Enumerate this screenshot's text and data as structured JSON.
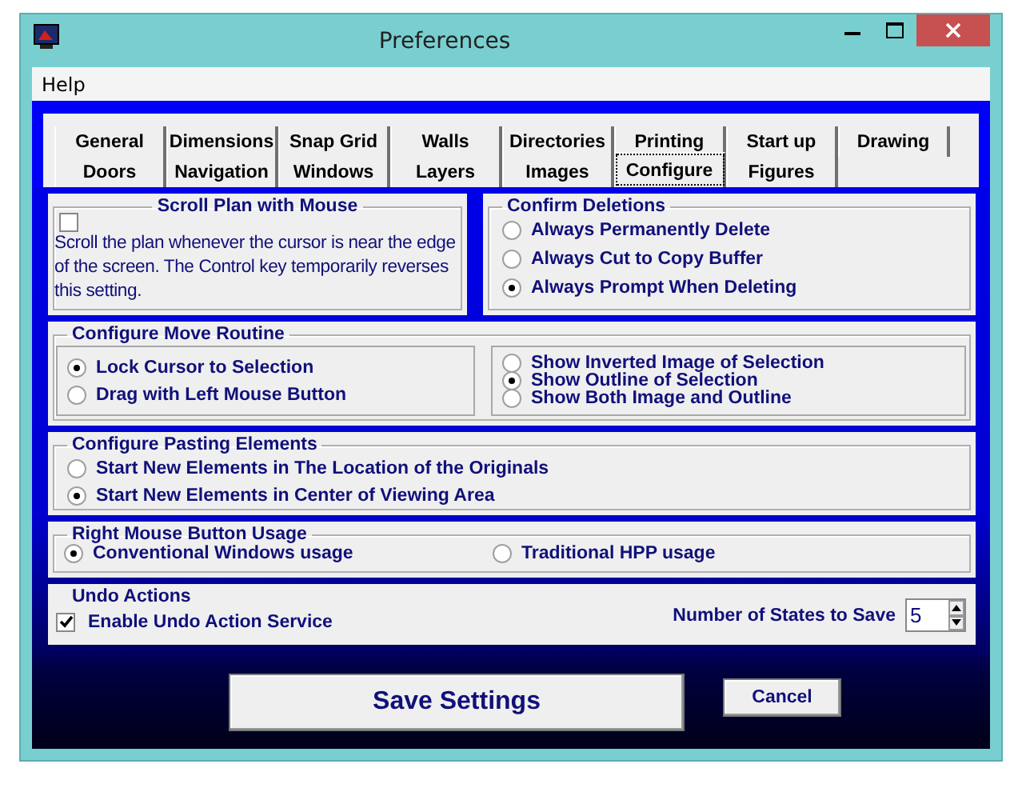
{
  "window": {
    "title": "Preferences"
  },
  "menu": [
    {
      "label": "Help"
    }
  ],
  "tab_rows": [
    {
      "tabs": [
        {
          "label": "General",
          "selected": false
        },
        {
          "label": "Dimensions",
          "selected": false
        },
        {
          "label": "Snap Grid",
          "selected": false
        },
        {
          "label": "Walls",
          "selected": false
        },
        {
          "label": "Directories",
          "selected": false
        },
        {
          "label": "Printing",
          "selected": false
        },
        {
          "label": "Start up",
          "selected": false
        },
        {
          "label": "Drawing",
          "selected": false
        }
      ]
    },
    {
      "tabs": [
        {
          "label": "Doors",
          "selected": false
        },
        {
          "label": "Navigation",
          "selected": false
        },
        {
          "label": "Windows",
          "selected": false
        },
        {
          "label": "Layers",
          "selected": false
        },
        {
          "label": "Images",
          "selected": false
        },
        {
          "label": "Configure",
          "selected": true
        },
        {
          "label": "Figures",
          "selected": false
        }
      ]
    }
  ],
  "scroll_plan": {
    "title": "Scroll Plan with Mouse",
    "checked": false,
    "description": "Scroll the plan whenever the cursor is near the edge of the screen. The Control key temporarily reverses this setting."
  },
  "confirm_deletions": {
    "title": "Confirm Deletions",
    "options": [
      {
        "label": "Always Permanently Delete",
        "selected": false
      },
      {
        "label": "Always Cut to Copy Buffer",
        "selected": false
      },
      {
        "label": "Always Prompt When Deleting",
        "selected": true
      }
    ]
  },
  "move_routine": {
    "title": "Configure Move Routine",
    "cursor_options": [
      {
        "label": "Lock Cursor to Selection",
        "selected": true
      },
      {
        "label": "Drag with Left Mouse Button",
        "selected": false
      }
    ],
    "display_options": [
      {
        "label": "Show Inverted Image of Selection",
        "selected": false
      },
      {
        "label": "Show Outline of Selection",
        "selected": true
      },
      {
        "label": "Show Both Image and Outline",
        "selected": false
      }
    ]
  },
  "pasting": {
    "title": "Configure Pasting Elements",
    "options": [
      {
        "label": "Start New Elements in The Location of the Originals",
        "selected": false
      },
      {
        "label": "Start New Elements in Center of Viewing Area",
        "selected": true
      }
    ]
  },
  "right_mouse": {
    "title": "Right Mouse Button Usage",
    "options": [
      {
        "label": "Conventional Windows usage",
        "selected": true
      },
      {
        "label": "Traditional HPP usage",
        "selected": false
      }
    ]
  },
  "undo": {
    "title": "Undo Actions",
    "enable": {
      "label": "Enable Undo Action Service",
      "checked": true
    },
    "states": {
      "label": "Number of States to Save",
      "value": "5"
    }
  },
  "buttons": [
    {
      "label": "Save Settings",
      "kind": "primary"
    },
    {
      "label": "Cancel",
      "kind": "secondary"
    }
  ]
}
